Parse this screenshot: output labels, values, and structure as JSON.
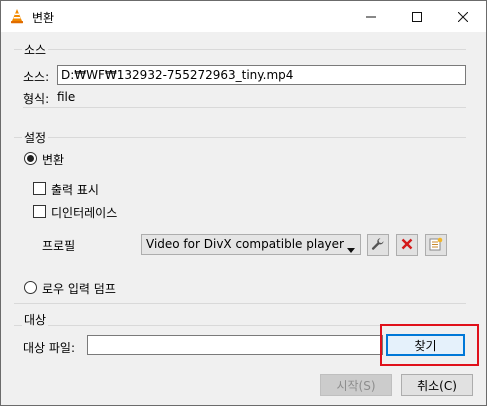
{
  "window": {
    "title": "변환",
    "minimize_icon": "minimize-icon",
    "maximize_icon": "maximize-icon",
    "close_icon": "close-icon"
  },
  "source": {
    "group_label": "소스",
    "label": "소스:",
    "value": "D:₩WF₩132932-755272963_tiny.mp4",
    "type_label": "형식:",
    "type_value": "file"
  },
  "settings": {
    "group_label": "설정",
    "convert_label": "변환",
    "convert_selected": true,
    "show_output_label": "출력 표시",
    "show_output_checked": false,
    "deinterlace_label": "디인터레이스",
    "deinterlace_checked": false,
    "profile_label": "프로필",
    "profile_value": "Video for DivX compatible player",
    "raw_dump_label": "로우 입력 덤프",
    "raw_dump_selected": false
  },
  "destination": {
    "group_label": "대상",
    "file_label": "대상 파일:",
    "file_value": "",
    "browse_label": "찾기"
  },
  "footer": {
    "start_label": "시작(S)",
    "cancel_label": "취소(C)"
  },
  "colors": {
    "highlight": "#e0101a",
    "accent": "#0078d7"
  }
}
